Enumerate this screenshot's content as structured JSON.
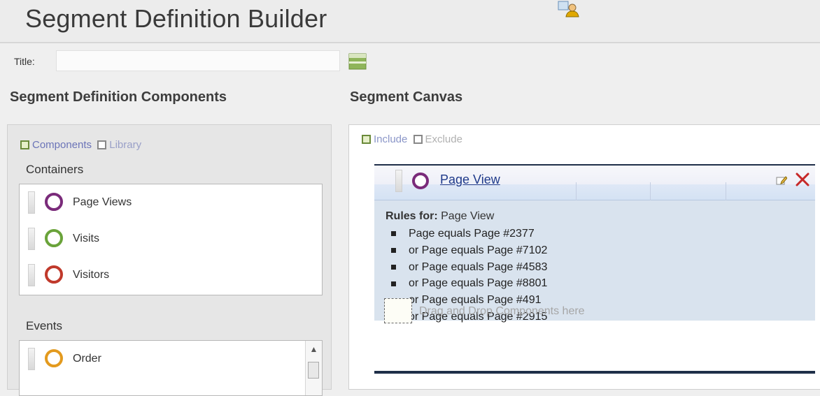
{
  "header": {
    "title": "Segment Definition Builder"
  },
  "title_field": {
    "label": "Title:",
    "value": "",
    "placeholder": ""
  },
  "left": {
    "section_title": "Segment Definition Components",
    "tabs": [
      {
        "label": "Components",
        "active": true
      },
      {
        "label": "Library",
        "active": false
      }
    ],
    "containers_label": "Containers",
    "containers": [
      {
        "label": "Page Views",
        "icon": "page-views-icon",
        "color": "#7a2b7a"
      },
      {
        "label": "Visits",
        "icon": "visits-icon",
        "color": "#6aa33a"
      },
      {
        "label": "Visitors",
        "icon": "visitors-icon",
        "color": "#c0392b"
      }
    ],
    "events_label": "Events",
    "events": [
      {
        "label": "Order",
        "icon": "order-icon",
        "color": "#e39a1e"
      }
    ]
  },
  "right": {
    "section_title": "Segment Canvas",
    "tabs": [
      {
        "label": "Include",
        "active": true
      },
      {
        "label": "Exclude",
        "active": false
      }
    ],
    "card": {
      "title": "Page View",
      "rules_prefix": "Rules for:",
      "rules_target": "Page View",
      "rules": [
        "Page equals Page #2377",
        "or Page equals Page #7102",
        "or Page equals Page #4583",
        "or Page equals Page #8801",
        "or Page equals Page #491",
        "or Page equals Page #2915"
      ],
      "drop_hint": "Drag and Drop Components here"
    }
  }
}
